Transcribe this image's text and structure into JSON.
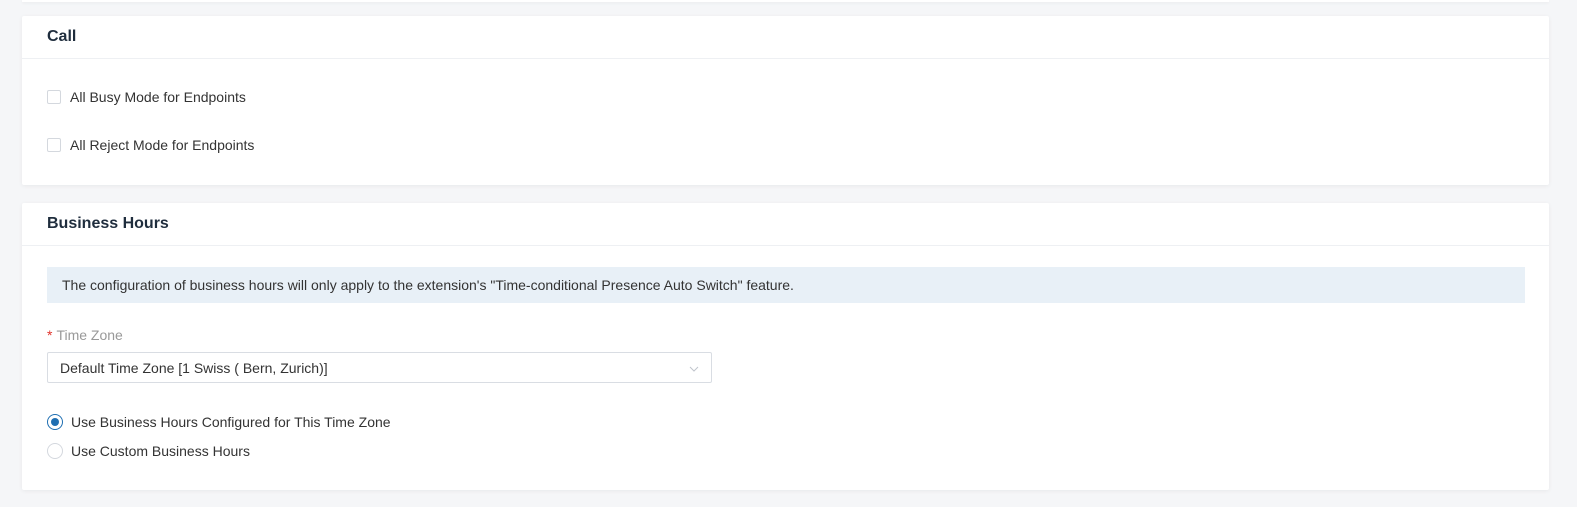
{
  "call_section": {
    "title": "Call",
    "options": [
      {
        "label": "All Busy Mode for Endpoints",
        "checked": false
      },
      {
        "label": "All Reject Mode for Endpoints",
        "checked": false
      }
    ]
  },
  "business_hours": {
    "title": "Business Hours",
    "notice": "The configuration of business hours will only apply to the extension's \"Time-conditional Presence Auto Switch\" feature.",
    "time_zone": {
      "required_marker": "*",
      "label": "Time Zone",
      "value": "Default Time Zone [1 Swiss ( Bern, Zurich)]"
    },
    "options": [
      {
        "label": "Use Business Hours Configured for This Time Zone",
        "selected": true
      },
      {
        "label": "Use Custom Business Hours",
        "selected": false
      }
    ]
  },
  "colors": {
    "accent": "#1f6fb2",
    "notice_bg": "#e8f0f7",
    "required": "#e0322a"
  },
  "icons": {
    "dropdown": "chevron-down-icon"
  }
}
